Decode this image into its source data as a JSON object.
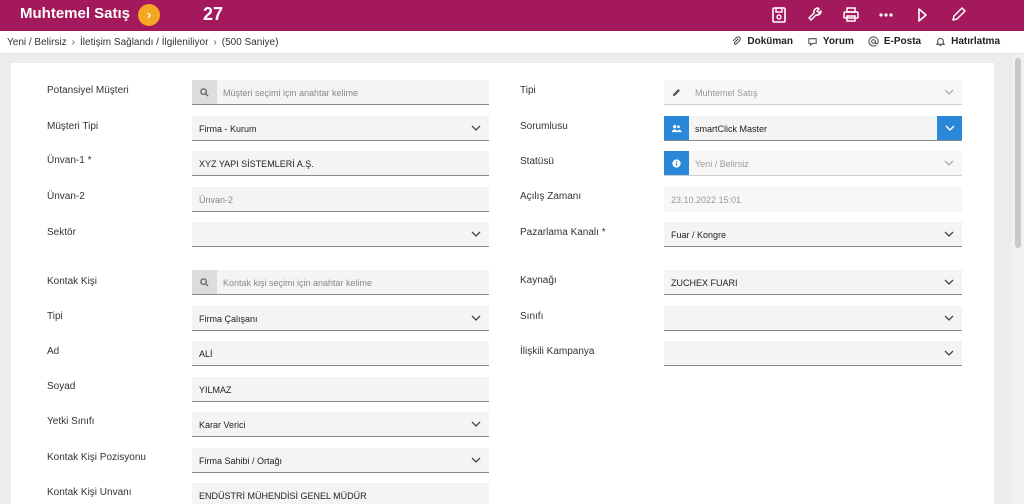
{
  "header": {
    "title": "Muhtemel Satış",
    "nav_icon": "chevron-right-icon",
    "record_number": "27",
    "toolbar_icons": [
      "save-icon",
      "wrench-icon",
      "print-icon",
      "more-icon",
      "play-icon",
      "edit-icon"
    ]
  },
  "breadcrumb": {
    "items": [
      "Yeni / Belirsiz",
      "İletişim Sağlandı / İlgileniliyor",
      "(500 Saniye)"
    ]
  },
  "actions": {
    "document": "Doküman",
    "comment": "Yorum",
    "email": "E-Posta",
    "reminder": "Hatırlatma"
  },
  "left": {
    "potential_customer": {
      "label": "Potansiyel Müşteri",
      "placeholder": "Müşteri seçimi için anahtar kelime"
    },
    "customer_type": {
      "label": "Müşteri Tipi",
      "value": "Firma - Kurum"
    },
    "title1": {
      "label": "Ünvan-1",
      "required": "*",
      "value": "XYZ YAPI  SİSTEMLERİ A.Ş."
    },
    "title2": {
      "label": "Ünvan-2",
      "placeholder": "Ünvan-2"
    },
    "sector": {
      "label": "Sektör",
      "value": ""
    },
    "contact_person": {
      "label": "Kontak Kişi",
      "placeholder": "Kontak kişi seçimi için anahtar kelime"
    },
    "contact_type": {
      "label": "Tipi",
      "value": "Firma Çalışanı"
    },
    "first_name": {
      "label": "Ad",
      "value": "ALİ"
    },
    "last_name": {
      "label": "Soyad",
      "value": "YILMAZ"
    },
    "authority": {
      "label": "Yetki Sınıfı",
      "value": "Karar Verici"
    },
    "position": {
      "label": "Kontak Kişi Pozisyonu",
      "value": "Firma Sahibi / Ortağı"
    },
    "contact_title": {
      "label": "Kontak Kişi Unvanı",
      "value": "ENDÜSTRİ MÜHENDİSİ GENEL MÜDÜR"
    }
  },
  "right": {
    "type": {
      "label": "Tipi",
      "value": "Muhtemel Satış"
    },
    "owner": {
      "label": "Sorumlusu",
      "value": "smartClick Master"
    },
    "status": {
      "label": "Statüsü",
      "value": "Yeni / Belirsiz"
    },
    "opened_at": {
      "label": "Açılış Zamanı",
      "value": "23.10.2022 15:01"
    },
    "channel": {
      "label": "Pazarlama Kanalı",
      "required": "*",
      "value": "Fuar / Kongre"
    },
    "source": {
      "label": "Kaynağı",
      "value": "ZUCHEX FUARI"
    },
    "class": {
      "label": "Sınıfı",
      "value": ""
    },
    "campaign": {
      "label": "İlişkili Kampanya",
      "value": ""
    }
  },
  "colors": {
    "brand": "#a3195b",
    "accent": "#f5a623",
    "blue": "#2b88d8"
  }
}
